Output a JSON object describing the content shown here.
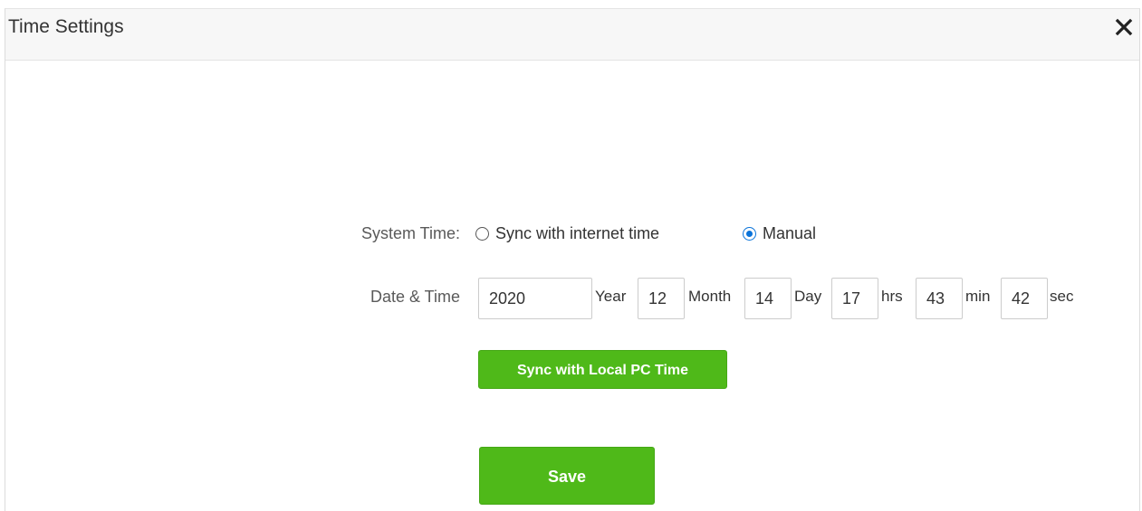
{
  "dialog": {
    "title": "Time Settings",
    "close_icon": "close-icon"
  },
  "system_time": {
    "label": "System Time:",
    "options": [
      {
        "label": "Sync with internet time",
        "checked": false
      },
      {
        "label": "Manual",
        "checked": true
      }
    ]
  },
  "date_time": {
    "label": "Date & Time",
    "year": {
      "value": "2020",
      "unit": "Year"
    },
    "month": {
      "value": "12",
      "unit": "Month"
    },
    "day": {
      "value": "14",
      "unit": "Day"
    },
    "hrs": {
      "value": "17",
      "unit": "hrs"
    },
    "min": {
      "value": "43",
      "unit": "min"
    },
    "sec": {
      "value": "42",
      "unit": "sec"
    }
  },
  "buttons": {
    "sync_pc_label": "Sync with Local PC Time",
    "save_label": "Save"
  },
  "colors": {
    "accent_green": "#4fb919",
    "radio_blue": "#0a73d9"
  }
}
